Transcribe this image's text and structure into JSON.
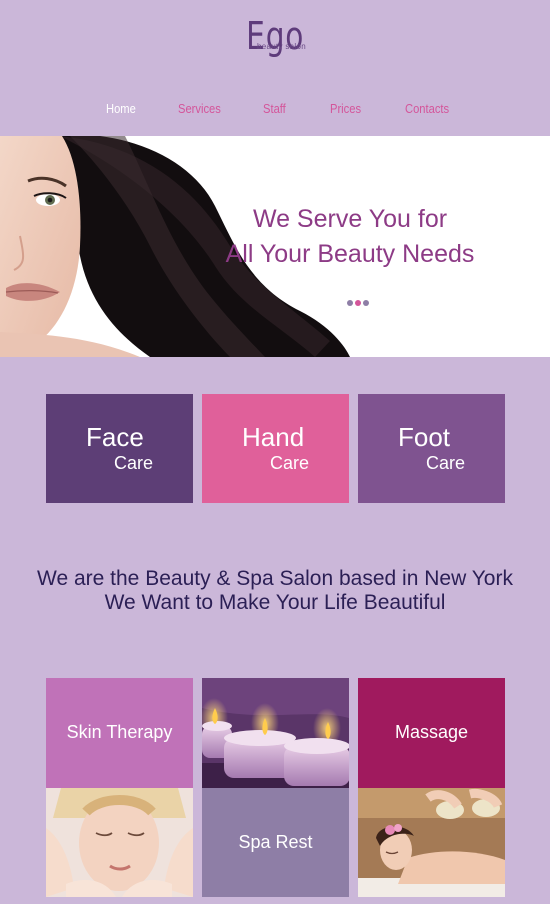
{
  "header": {
    "logo_text": "Ego",
    "logo_subtitle": "beauty salon"
  },
  "nav": {
    "items": [
      {
        "label": "Home",
        "active": true
      },
      {
        "label": "Services",
        "active": false
      },
      {
        "label": "Staff",
        "active": false
      },
      {
        "label": "Prices",
        "active": false
      },
      {
        "label": "Contacts",
        "active": false
      }
    ]
  },
  "hero": {
    "title_line1": "We Serve You for",
    "title_line2": "All Your Beauty Needs",
    "slides": 3,
    "active_slide": 2
  },
  "care": {
    "face": {
      "line1": "Face",
      "line2": "Care"
    },
    "hand": {
      "line1": "Hand",
      "line2": "Care"
    },
    "foot": {
      "line1": "Foot",
      "line2": "Care"
    }
  },
  "tagline": {
    "line1": "We are the Beauty & Spa Salon based in New York",
    "line2": "We Want to Make Your Life Beautiful"
  },
  "services": {
    "skin": "Skin Therapy",
    "massage": "Massage",
    "spa": "Spa Rest"
  },
  "colors": {
    "background": "#cbb7d9",
    "nav_link": "#d4559a",
    "face_tile": "#5d3e76",
    "hand_tile": "#e0609a",
    "foot_tile": "#7f5390",
    "skin_tile": "#c072b8",
    "massage_tile": "#a01a5e",
    "spa_tile": "#8e7ea6",
    "hero_title": "#8d3b86",
    "tagline": "#2b1f55"
  }
}
